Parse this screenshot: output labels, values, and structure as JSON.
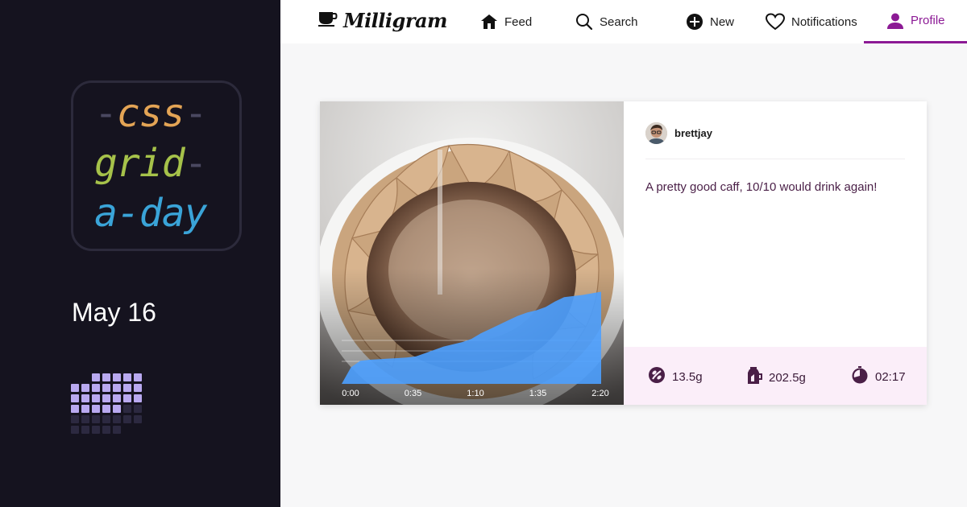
{
  "sidebar": {
    "logo": {
      "line1": "css",
      "line2": "grid",
      "line3": "a-day"
    },
    "date": "May 16",
    "calendar": [
      [
        "none",
        "none",
        "on",
        "on",
        "on",
        "on",
        "on"
      ],
      [
        "on",
        "on",
        "on",
        "on",
        "on",
        "on",
        "on"
      ],
      [
        "on",
        "on",
        "on",
        "on",
        "on",
        "on",
        "on"
      ],
      [
        "on",
        "on",
        "on",
        "on",
        "on",
        "off",
        "off"
      ],
      [
        "off",
        "off",
        "off",
        "off",
        "off",
        "off",
        "off"
      ],
      [
        "off",
        "off",
        "off",
        "off",
        "off",
        "none",
        "none"
      ]
    ]
  },
  "nav": {
    "brand": "Milligram",
    "items": [
      {
        "label": "Feed",
        "icon": "home-icon"
      },
      {
        "label": "Search",
        "icon": "search-icon"
      },
      {
        "label": "New",
        "icon": "plus-circle-icon"
      },
      {
        "label": "Notifications",
        "icon": "heart-icon"
      },
      {
        "label": "Profile",
        "icon": "user-icon",
        "active": true
      }
    ],
    "active_color": "#8c1a95"
  },
  "post": {
    "username": "brettjay",
    "caption": "A pretty good caff, 10/10 would drink again!",
    "stats": {
      "beans": "13.5g",
      "water": "202.5g",
      "time": "02:17"
    }
  },
  "chart_data": {
    "type": "area",
    "x_ticks": [
      "0:00",
      "0:35",
      "1:10",
      "1:35",
      "2:20"
    ],
    "x": [
      0,
      5,
      10,
      15,
      20,
      25,
      30,
      35,
      40,
      45,
      50,
      55,
      60,
      65,
      70,
      75,
      80,
      85,
      90,
      95,
      100,
      105,
      110,
      115,
      120,
      125,
      130,
      135,
      140
    ],
    "y": [
      0,
      30,
      42,
      44,
      45,
      46,
      47,
      48,
      50,
      56,
      62,
      68,
      72,
      76,
      82,
      92,
      100,
      108,
      116,
      124,
      130,
      134,
      140,
      150,
      158,
      160,
      162,
      165,
      168
    ],
    "ylim": [
      0,
      220
    ],
    "color": "#4da0ff"
  }
}
